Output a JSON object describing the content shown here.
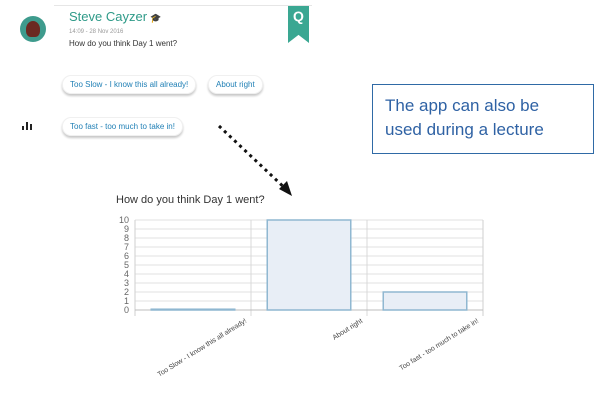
{
  "post": {
    "author": "Steve Cayzer",
    "author_badge": "graduation-cap-icon",
    "timestamp": "14:09 - 28 Nov 2016",
    "question": "How do you think Day 1 went?",
    "bookmark_letter": "Q"
  },
  "options": [
    "Too Slow - I know this all already!",
    "About right",
    "Too fast - too much to take in!"
  ],
  "callout": {
    "line1": "The app can also be",
    "line2": "used during a lecture",
    "border_color": "#2f6aa6",
    "text_color": "#2f62a4"
  },
  "colors": {
    "accent": "#2e9a88",
    "link": "#1f7fb5"
  },
  "chart_data": {
    "type": "bar",
    "title": "How do you think Day 1 went?",
    "categories": [
      "Too Slow - I know this all already!",
      "About right",
      "Too fast - too much to take in!"
    ],
    "values": [
      0,
      10,
      2
    ],
    "ylim": [
      0,
      10
    ],
    "yticks": [
      0,
      1,
      2,
      3,
      4,
      5,
      6,
      7,
      8,
      9,
      10
    ],
    "grid": true,
    "bar_fill": "#e8eef6",
    "bar_stroke": "#8fb7d1"
  }
}
